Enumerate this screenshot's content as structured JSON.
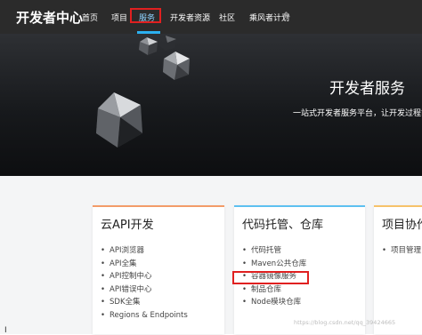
{
  "nav": {
    "brand": "开发者中心",
    "items": [
      {
        "label": "首页"
      },
      {
        "label": "项目"
      },
      {
        "label": "服务",
        "active": true
      },
      {
        "label": "开发者资源"
      },
      {
        "label": "社区"
      },
      {
        "label": "乘风者计划"
      }
    ],
    "active_color": "#2bb0f0",
    "highlight_color": "#e02020"
  },
  "hero": {
    "title": "开发者服务",
    "subtitle": "一站式开发者服务平台，让开发过程简"
  },
  "cards": [
    {
      "title": "云API开发",
      "items": [
        "API浏览器",
        "API全集",
        "API控制中心",
        "API错误中心",
        "SDK全集",
        "Regions & Endpoints"
      ]
    },
    {
      "title": "代码托管、仓库",
      "items": [
        "代码托管",
        "Maven公共仓库",
        "容器镜像服务",
        "制品仓库",
        "Node模块仓库"
      ],
      "highlighted": "容器镜像服务"
    },
    {
      "title": "项目协作",
      "items": [
        "项目管理"
      ]
    }
  ],
  "watermark": "https://blog.csdn.net/qq_39424665"
}
